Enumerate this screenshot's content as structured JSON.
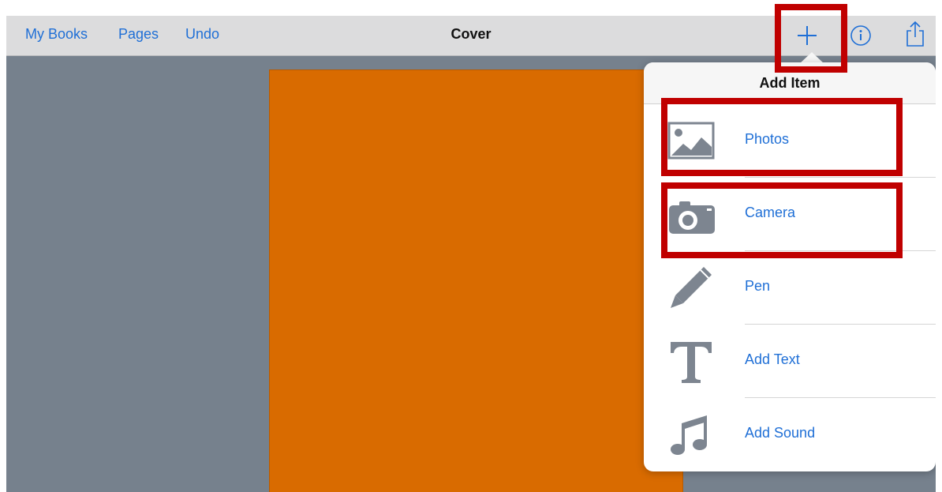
{
  "toolbar": {
    "my_books": "My Books",
    "pages": "Pages",
    "undo": "Undo",
    "title": "Cover",
    "icons": [
      "add-icon",
      "info-icon",
      "share-icon"
    ]
  },
  "popover": {
    "title": "Add Item",
    "items": [
      {
        "label": "Photos",
        "icon": "photos-icon"
      },
      {
        "label": "Camera",
        "icon": "camera-icon"
      },
      {
        "label": "Pen",
        "icon": "pen-icon"
      },
      {
        "label": "Add Text",
        "icon": "text-icon"
      },
      {
        "label": "Add Sound",
        "icon": "sound-icon"
      }
    ]
  },
  "colors": {
    "accent": "#1f6fd6",
    "canvas": "#76818d",
    "cover_page": "#d96b00",
    "highlight": "#c00000"
  }
}
